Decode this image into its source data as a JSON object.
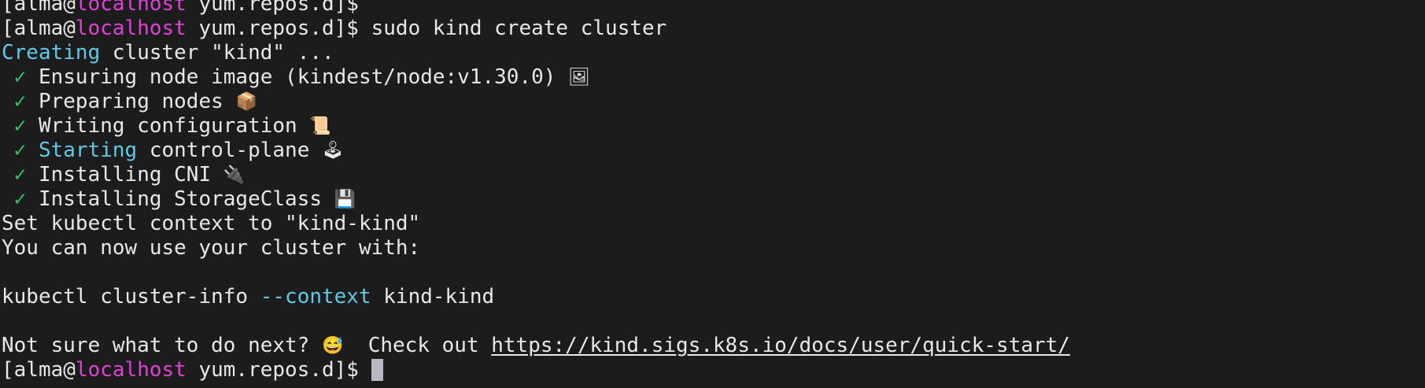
{
  "colors": {
    "background": "#1c1c1c",
    "foreground": "#e8e8e8",
    "accent_blue": "#5fc9e8",
    "hostname_magenta": "#e040d8",
    "check_green": "#2fc46a"
  },
  "prompt": {
    "open": "[alma@",
    "host": "localhost",
    "path_close": " yum.repos.d]$ "
  },
  "top_partial": "",
  "command": "sudo kind create cluster",
  "creating": {
    "verb": "Creating",
    "rest": " cluster \"kind\" ..."
  },
  "steps": [
    {
      "check": "✓",
      "prefix": "",
      "label": "Ensuring node image (kindest/node:v1.30.0)",
      "icon": "🖼",
      "icon_name": "image-icon"
    },
    {
      "check": "✓",
      "prefix": "",
      "label": "Preparing nodes",
      "icon": "📦",
      "icon_name": "box-icon"
    },
    {
      "check": "✓",
      "prefix": "",
      "label": "Writing configuration",
      "icon": "📜",
      "icon_name": "scroll-icon"
    },
    {
      "check": "✓",
      "prefix": "Starting",
      "label": " control-plane",
      "icon": "🕹",
      "icon_name": "joystick-icon"
    },
    {
      "check": "✓",
      "prefix": "",
      "label": "Installing CNI",
      "icon": "🔌",
      "icon_name": "plug-icon"
    },
    {
      "check": "✓",
      "prefix": "",
      "label": "Installing StorageClass",
      "icon": "💾",
      "icon_name": "floppy-disk-icon"
    }
  ],
  "context_set": "Set kubectl context to \"kind-kind\"",
  "use_cluster": "You can now use your cluster with:",
  "kubectl_cmd": {
    "part1": "kubectl cluster-info ",
    "flag": "--context",
    "part2": " kind-kind"
  },
  "next": {
    "question": "Not sure what to do next?",
    "emoji": "😅",
    "emoji_name": "grinning-sweat-icon",
    "check_out": "  Check out ",
    "url": "https://kind.sigs.k8s.io/docs/user/quick-start/"
  }
}
